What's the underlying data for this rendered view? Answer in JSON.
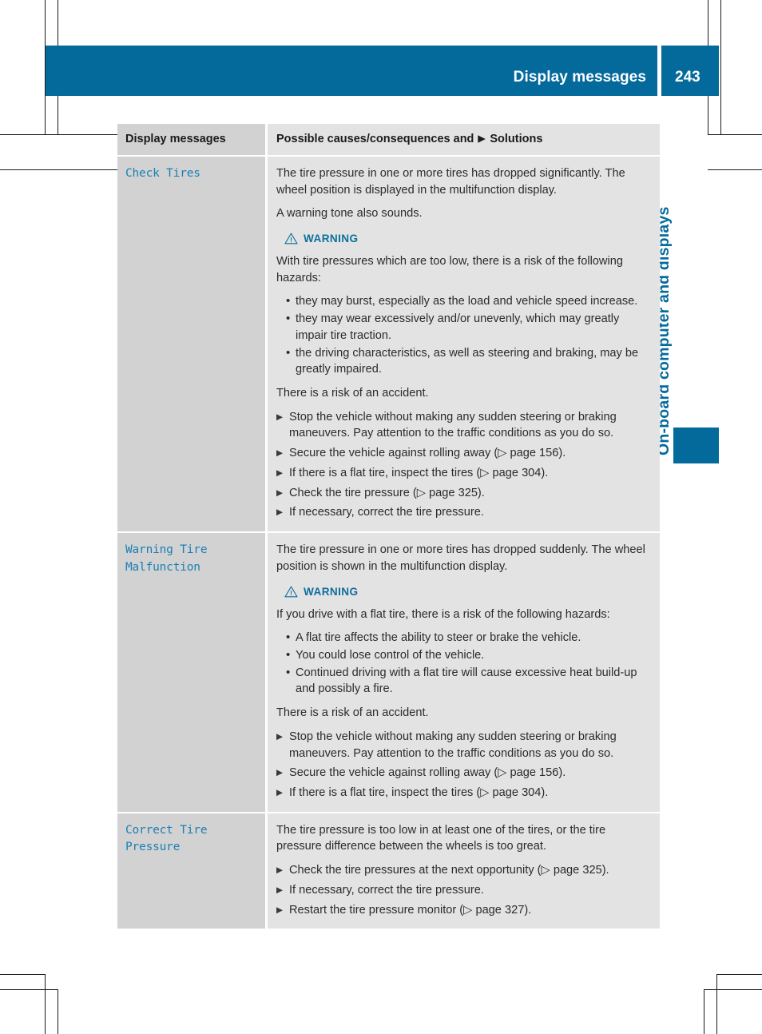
{
  "header": {
    "title": "Display messages",
    "page_number": "243"
  },
  "side_tab": {
    "label": "On-board computer and displays"
  },
  "table": {
    "columns": {
      "left": "Display messages",
      "right_prefix": "Possible causes/consequences and",
      "right_arrow": "▶",
      "right_suffix": "Solutions"
    },
    "rows": [
      {
        "message": "Check Tires",
        "paragraphs": [
          "The tire pressure in one or more tires has dropped significantly. The wheel position is displayed in the multifunction display.",
          "A warning tone also sounds."
        ],
        "warning": {
          "icon": "warning-triangle-icon",
          "label": "WARNING",
          "intro": "With tire pressures which are too low, there is a risk of the following hazards:",
          "bullets": [
            "they may burst, especially as the load and vehicle speed increase.",
            "they may wear excessively and/or unevenly, which may greatly impair tire traction.",
            "the driving characteristics, as well as steering and braking, may be greatly impaired."
          ],
          "outro": "There is a risk of an accident."
        },
        "steps": [
          "Stop the vehicle without making any sudden steering or braking maneuvers. Pay attention to the traffic conditions as you do so.",
          "Secure the vehicle against rolling away (▷ page 156).",
          "If there is a flat tire, inspect the tires (▷ page 304).",
          "Check the tire pressure (▷ page 325).",
          "If necessary, correct the tire pressure."
        ]
      },
      {
        "message": "Warning Tire Malfunction",
        "paragraphs": [
          "The tire pressure in one or more tires has dropped suddenly. The wheel position is shown in the multifunction display."
        ],
        "warning": {
          "icon": "warning-triangle-icon",
          "label": "WARNING",
          "intro": "If you drive with a flat tire, there is a risk of the following hazards:",
          "bullets": [
            "A flat tire affects the ability to steer or brake the vehicle.",
            "You could lose control of the vehicle.",
            "Continued driving with a flat tire will cause excessive heat build-up and possibly a fire."
          ],
          "outro": "There is a risk of an accident."
        },
        "steps": [
          "Stop the vehicle without making any sudden steering or braking maneuvers. Pay attention to the traffic conditions as you do so.",
          "Secure the vehicle against rolling away (▷ page 156).",
          "If there is a flat tire, inspect the tires (▷ page 304)."
        ]
      },
      {
        "message": "Correct Tire Pressure",
        "paragraphs": [
          "The tire pressure is too low in at least one of the tires, or the tire pressure difference between the wheels is too great."
        ],
        "warning": null,
        "steps": [
          "Check the tire pressures at the next opportunity (▷ page 325).",
          "If necessary, correct the tire pressure.",
          "Restart the tire pressure monitor (▷ page 327)."
        ]
      }
    ]
  },
  "colors": {
    "brand_blue": "#046a9c",
    "message_blue": "#1b7fb5",
    "warning_blue": "#0f6f9e",
    "cell_left_bg": "#d2d2d2",
    "cell_right_bg": "#e3e3e3"
  }
}
